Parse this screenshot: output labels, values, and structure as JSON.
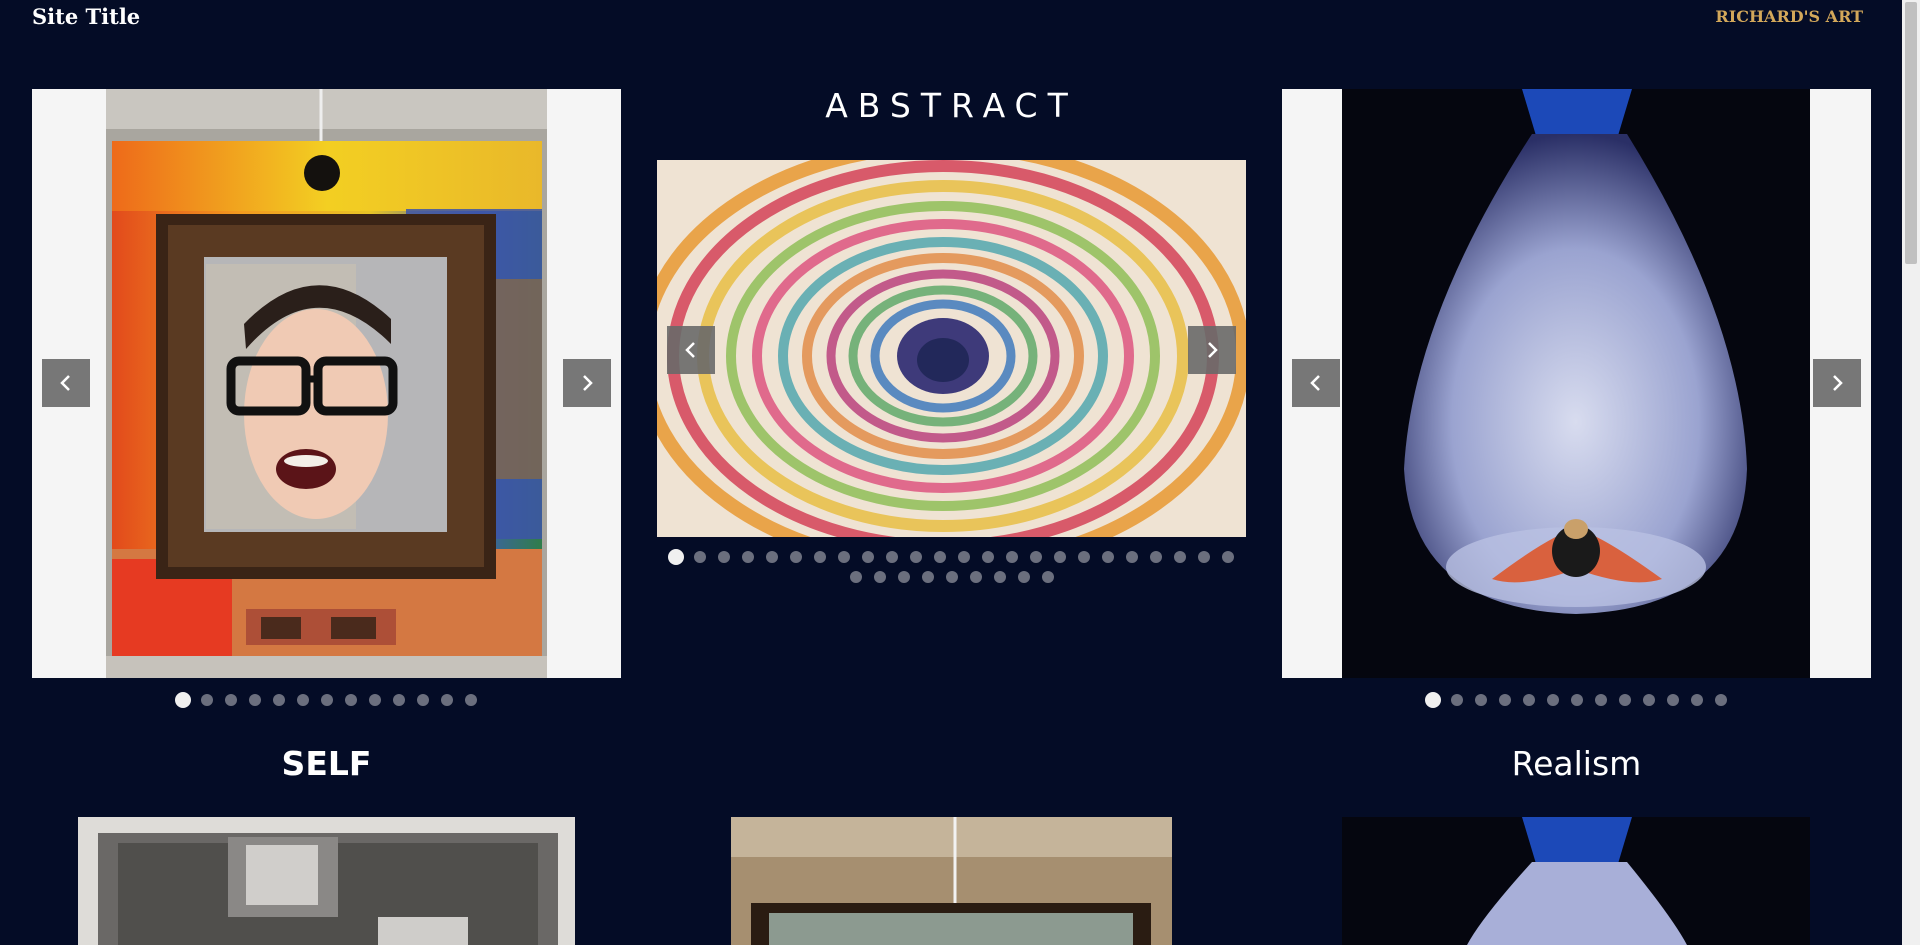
{
  "header": {
    "site_title": "Site Title",
    "nav_link": "RICHARD'S ART"
  },
  "left_gallery": {
    "slide_count": 13,
    "active_index": 0,
    "prev_icon": "chevron-left-icon",
    "next_icon": "chevron-right-icon"
  },
  "center_gallery": {
    "title": "ABSTRACT",
    "slide_count": 33,
    "active_index": 0,
    "prev_icon": "chevron-left-icon",
    "next_icon": "chevron-right-icon"
  },
  "right_gallery": {
    "slide_count": 13,
    "active_index": 0,
    "prev_icon": "chevron-left-icon",
    "next_icon": "chevron-right-icon"
  },
  "sections": {
    "self_title": "SELF",
    "realism_title": "Realism"
  },
  "colors": {
    "background": "#040c26",
    "accent_link": "#d3a85a",
    "arrow_bg": "#696969",
    "dot_inactive": "#6b6f7e",
    "dot_active": "#f0f0f0"
  }
}
